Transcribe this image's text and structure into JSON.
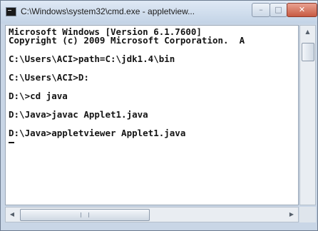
{
  "window": {
    "title": "C:\\Windows\\system32\\cmd.exe - appletview...",
    "controls": {
      "minimize": "–",
      "maximize": "□",
      "close": "✕"
    }
  },
  "console": {
    "lines": [
      "Microsoft Windows [Version 6.1.7600]",
      "Copyright (c) 2009 Microsoft Corporation.  A",
      "C:\\Users\\ACI>path=C:\\jdk1.4\\bin",
      "C:\\Users\\ACI>D:",
      "D:\\>cd java",
      "D:\\Java>javac Applet1.java",
      "D:\\Java>appletviewer Applet1.java"
    ]
  },
  "scrollbars": {
    "up_arrow": "▲",
    "left_arrow": "◀",
    "right_arrow": "▶"
  },
  "icons": {
    "app": "console-app-icon",
    "minimize": "minimize-icon",
    "maximize": "maximize-icon",
    "close": "close-icon"
  }
}
